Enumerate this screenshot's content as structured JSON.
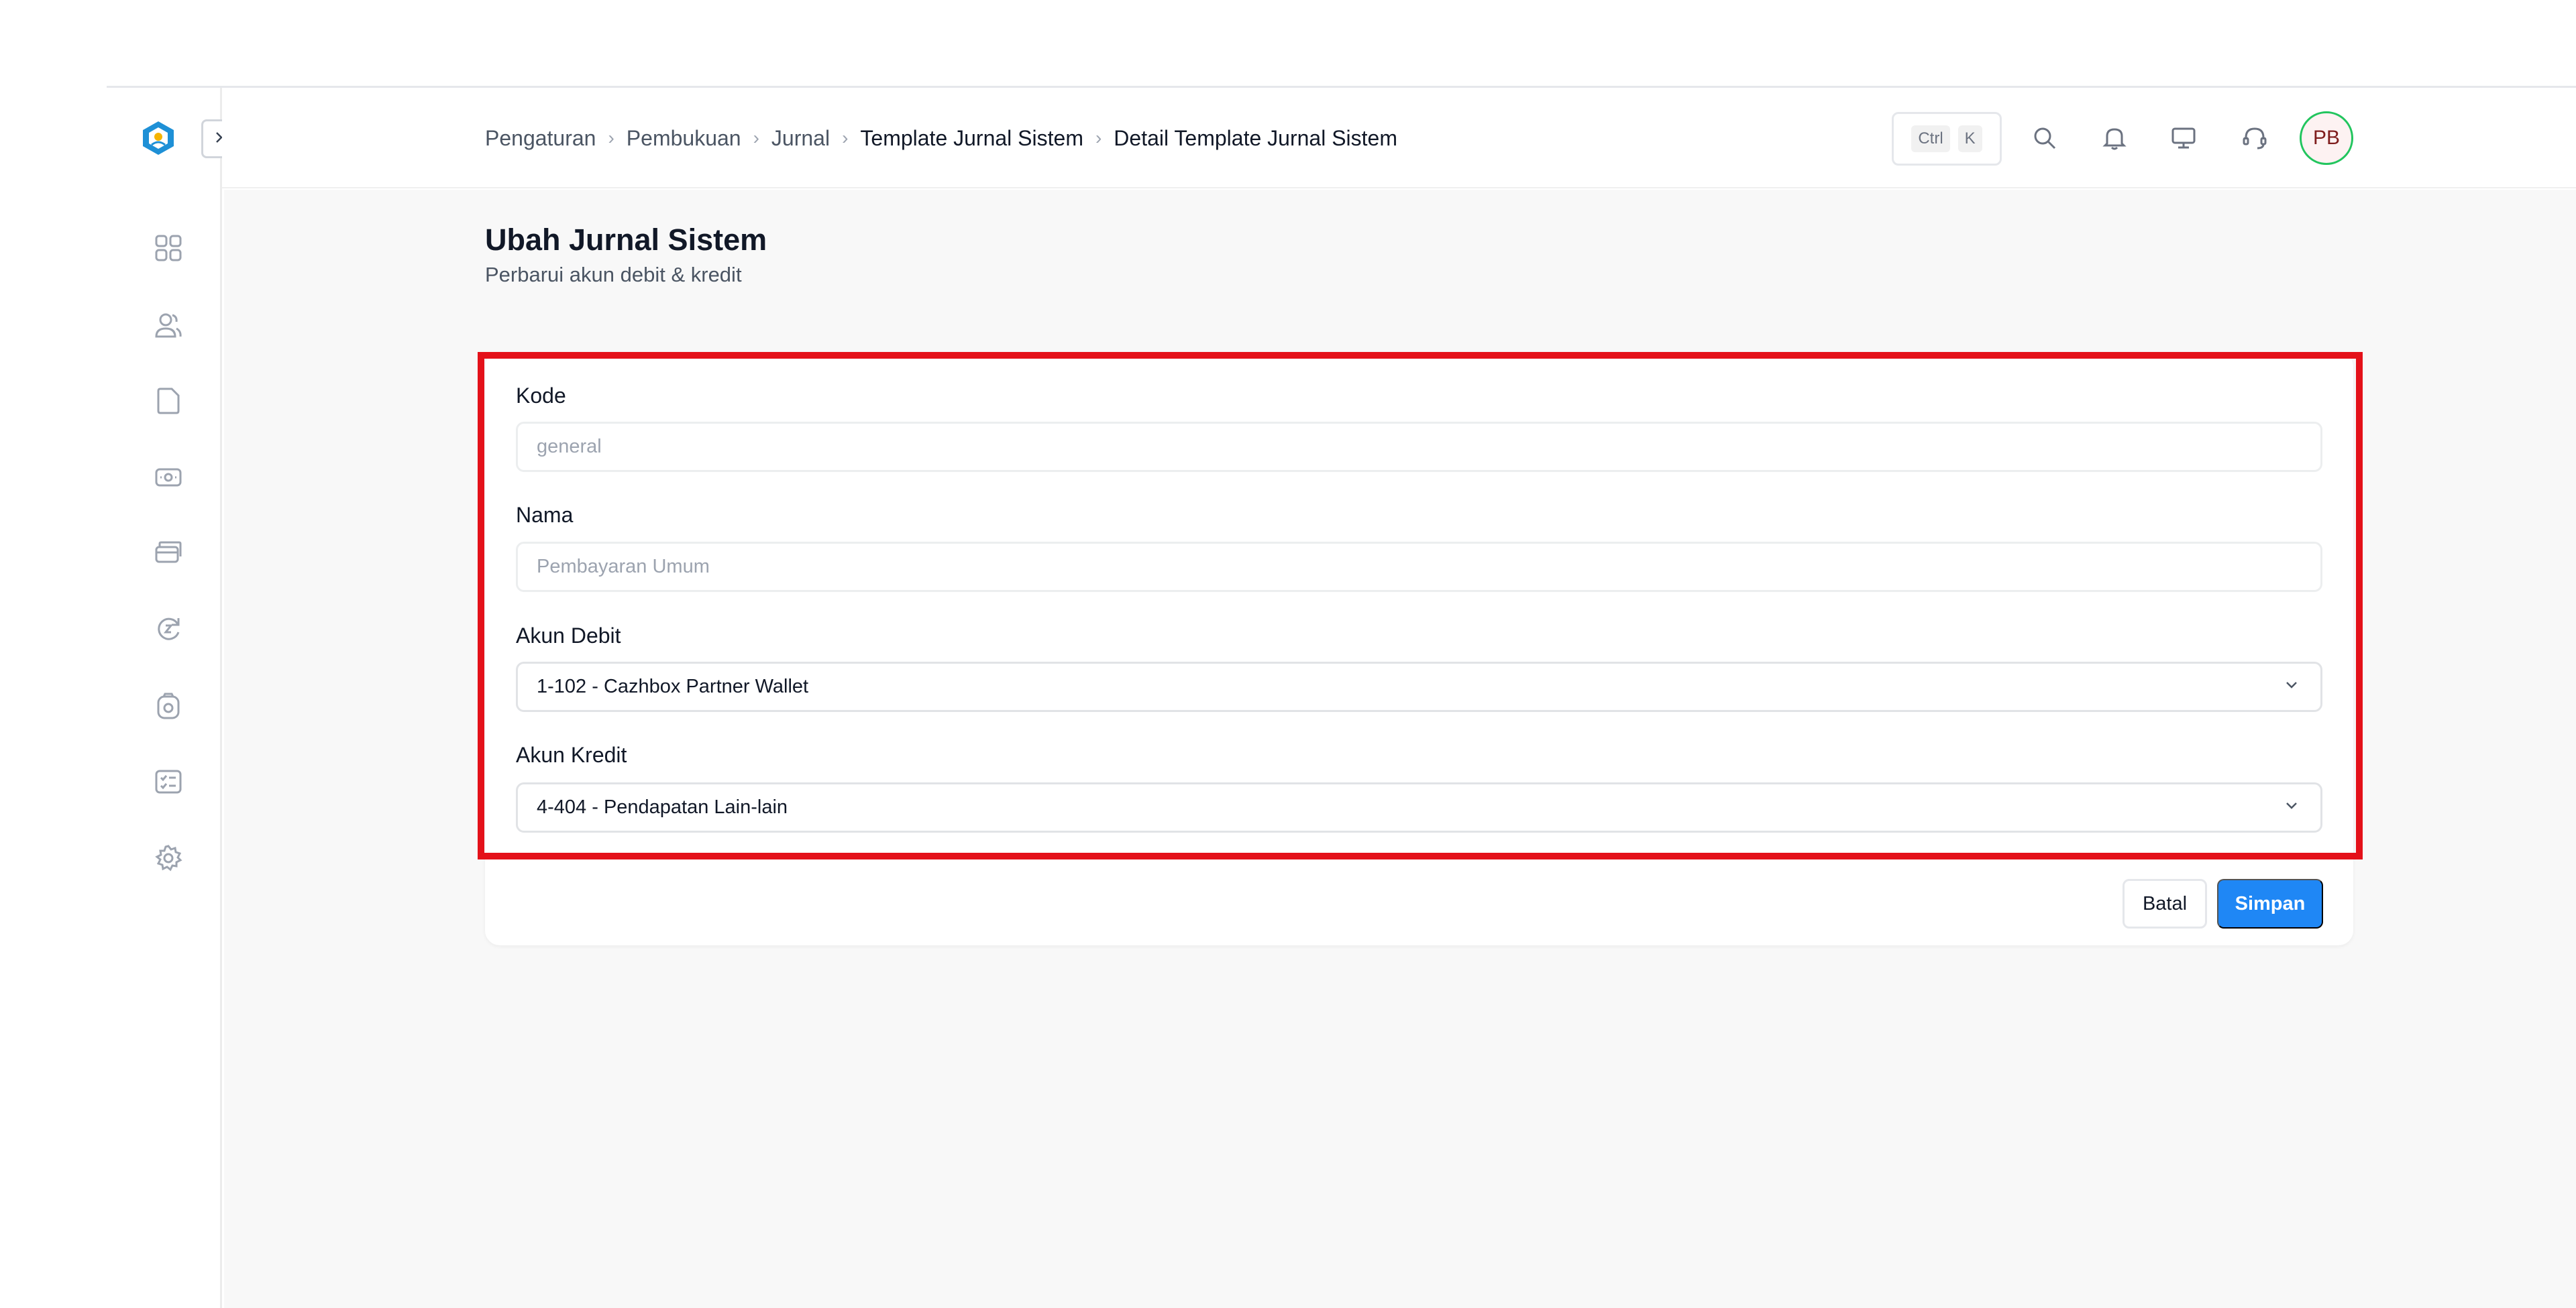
{
  "breadcrumb": {
    "items": [
      "Pengaturan",
      "Pembukuan",
      "Jurnal",
      "Template Jurnal Sistem",
      "Detail Template Jurnal Sistem"
    ],
    "separator": "›"
  },
  "header": {
    "shortcut_ctrl": "Ctrl",
    "shortcut_key": "K",
    "avatar_initials": "PB"
  },
  "page": {
    "title": "Ubah Jurnal Sistem",
    "subtitle": "Perbarui akun debit & kredit"
  },
  "form": {
    "kode": {
      "label": "Kode",
      "placeholder": "general"
    },
    "nama": {
      "label": "Nama",
      "placeholder": "Pembayaran Umum"
    },
    "akun_debit": {
      "label": "Akun Debit",
      "value": "1-102 - Cazhbox Partner Wallet"
    },
    "akun_kredit": {
      "label": "Akun Kredit",
      "value": "4-404 - Pendapatan Lain-lain"
    }
  },
  "actions": {
    "cancel_label": "Batal",
    "save_label": "Simpan"
  },
  "colors": {
    "primary": "#1f87f5",
    "highlight": "#e4111a",
    "avatar_ring": "#22c55e"
  },
  "icons": {
    "sidebar": [
      "dashboard-icon",
      "users-icon",
      "document-icon",
      "money-icon",
      "cards-icon",
      "sync-icon",
      "ring-icon",
      "checklist-icon",
      "settings-icon"
    ],
    "header": [
      "search-icon",
      "bell-icon",
      "monitor-icon",
      "headset-icon"
    ]
  }
}
